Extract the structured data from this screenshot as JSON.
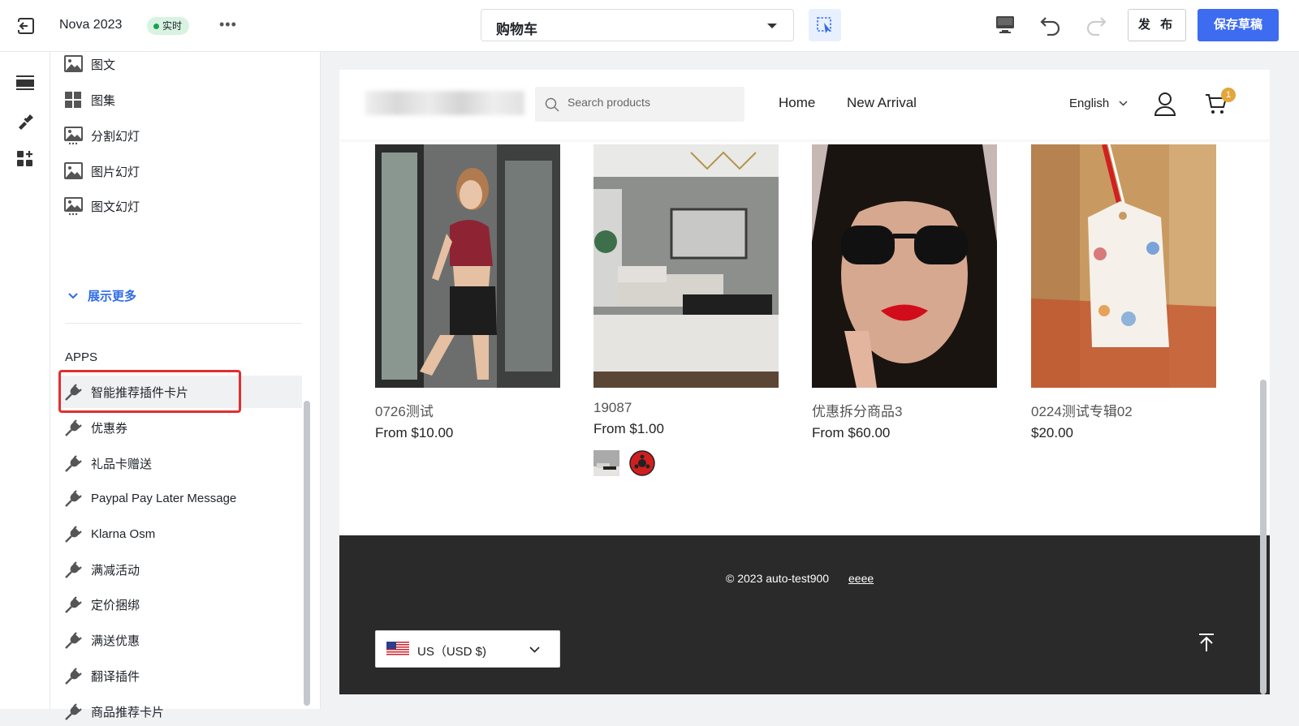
{
  "toolbar": {
    "title": "Nova 2023",
    "live_badge": "实时",
    "page_select_value": "购物车",
    "publish_label": "发 布",
    "save_label": "保存草稿"
  },
  "panel": {
    "sections": [
      {
        "label": "图文",
        "icon": "image-text-icon"
      },
      {
        "label": "图集",
        "icon": "gallery-icon"
      },
      {
        "label": "分割幻灯",
        "icon": "split-slideshow-icon"
      },
      {
        "label": "图片幻灯",
        "icon": "image-slideshow-icon"
      },
      {
        "label": "图文幻灯",
        "icon": "image-text-slideshow-icon"
      }
    ],
    "show_more": "展示更多",
    "apps_heading": "APPS",
    "apps": [
      {
        "label": "智能推荐插件卡片",
        "icon": "plug-icon"
      },
      {
        "label": "优惠券",
        "icon": "plug-icon"
      },
      {
        "label": "礼品卡赠送",
        "icon": "plug-icon"
      },
      {
        "label": "Paypal Pay Later Message",
        "icon": "plug-icon"
      },
      {
        "label": "Klarna Osm",
        "icon": "plug-icon"
      },
      {
        "label": "满减活动",
        "icon": "plug-icon"
      },
      {
        "label": "定价捆绑",
        "icon": "plug-icon"
      },
      {
        "label": "满送优惠",
        "icon": "plug-icon"
      },
      {
        "label": "翻译插件",
        "icon": "plug-icon"
      },
      {
        "label": "商品推荐卡片",
        "icon": "plug-icon"
      }
    ]
  },
  "store": {
    "search_placeholder": "Search products",
    "nav": [
      "Home",
      "New Arrival"
    ],
    "language": "English",
    "cart_count": "1",
    "products": [
      {
        "name": "0726测试",
        "price": "From $10.00"
      },
      {
        "name": "19087",
        "price": "From $1.00"
      },
      {
        "name": "优惠拆分商品3",
        "price": "From $60.00"
      },
      {
        "name": "0224测试专辑02",
        "price": "$20.00"
      }
    ],
    "footer": {
      "copyright": "© 2023 auto-test900",
      "link": "eeee",
      "currency": "US（USD $)"
    }
  },
  "colors": {
    "accent": "#3d6cf0",
    "live": "#1aa351",
    "highlight": "#e02f2f",
    "footer_bg": "#2a2a2a"
  }
}
